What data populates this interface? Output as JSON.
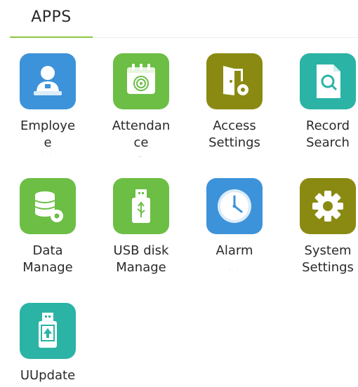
{
  "tabs": [
    {
      "label": "APPS"
    }
  ],
  "apps": [
    {
      "label": "Employe\ne",
      "icon": "employee-icon",
      "color": "#3d93d9"
    },
    {
      "label": "Attendan\nce",
      "icon": "attendance-icon",
      "color": "#6cbe45"
    },
    {
      "label": "Access\nSettings",
      "icon": "access-settings-icon",
      "color": "#8a8a12"
    },
    {
      "label": "Record\nSearch",
      "icon": "record-search-icon",
      "color": "#2bb3a6"
    },
    {
      "label": "Data\nManage",
      "icon": "data-manage-icon",
      "color": "#6cbe45"
    },
    {
      "label": "USB disk\nManage",
      "icon": "usb-disk-icon",
      "color": "#6cbe45"
    },
    {
      "label": "Alarm",
      "icon": "alarm-icon",
      "color": "#3d93d9"
    },
    {
      "label": "System\nSettings",
      "icon": "system-settings-icon",
      "color": "#8a8a12"
    },
    {
      "label": "UUpdate",
      "icon": "uupdate-icon",
      "color": "#2bb3a6"
    }
  ]
}
